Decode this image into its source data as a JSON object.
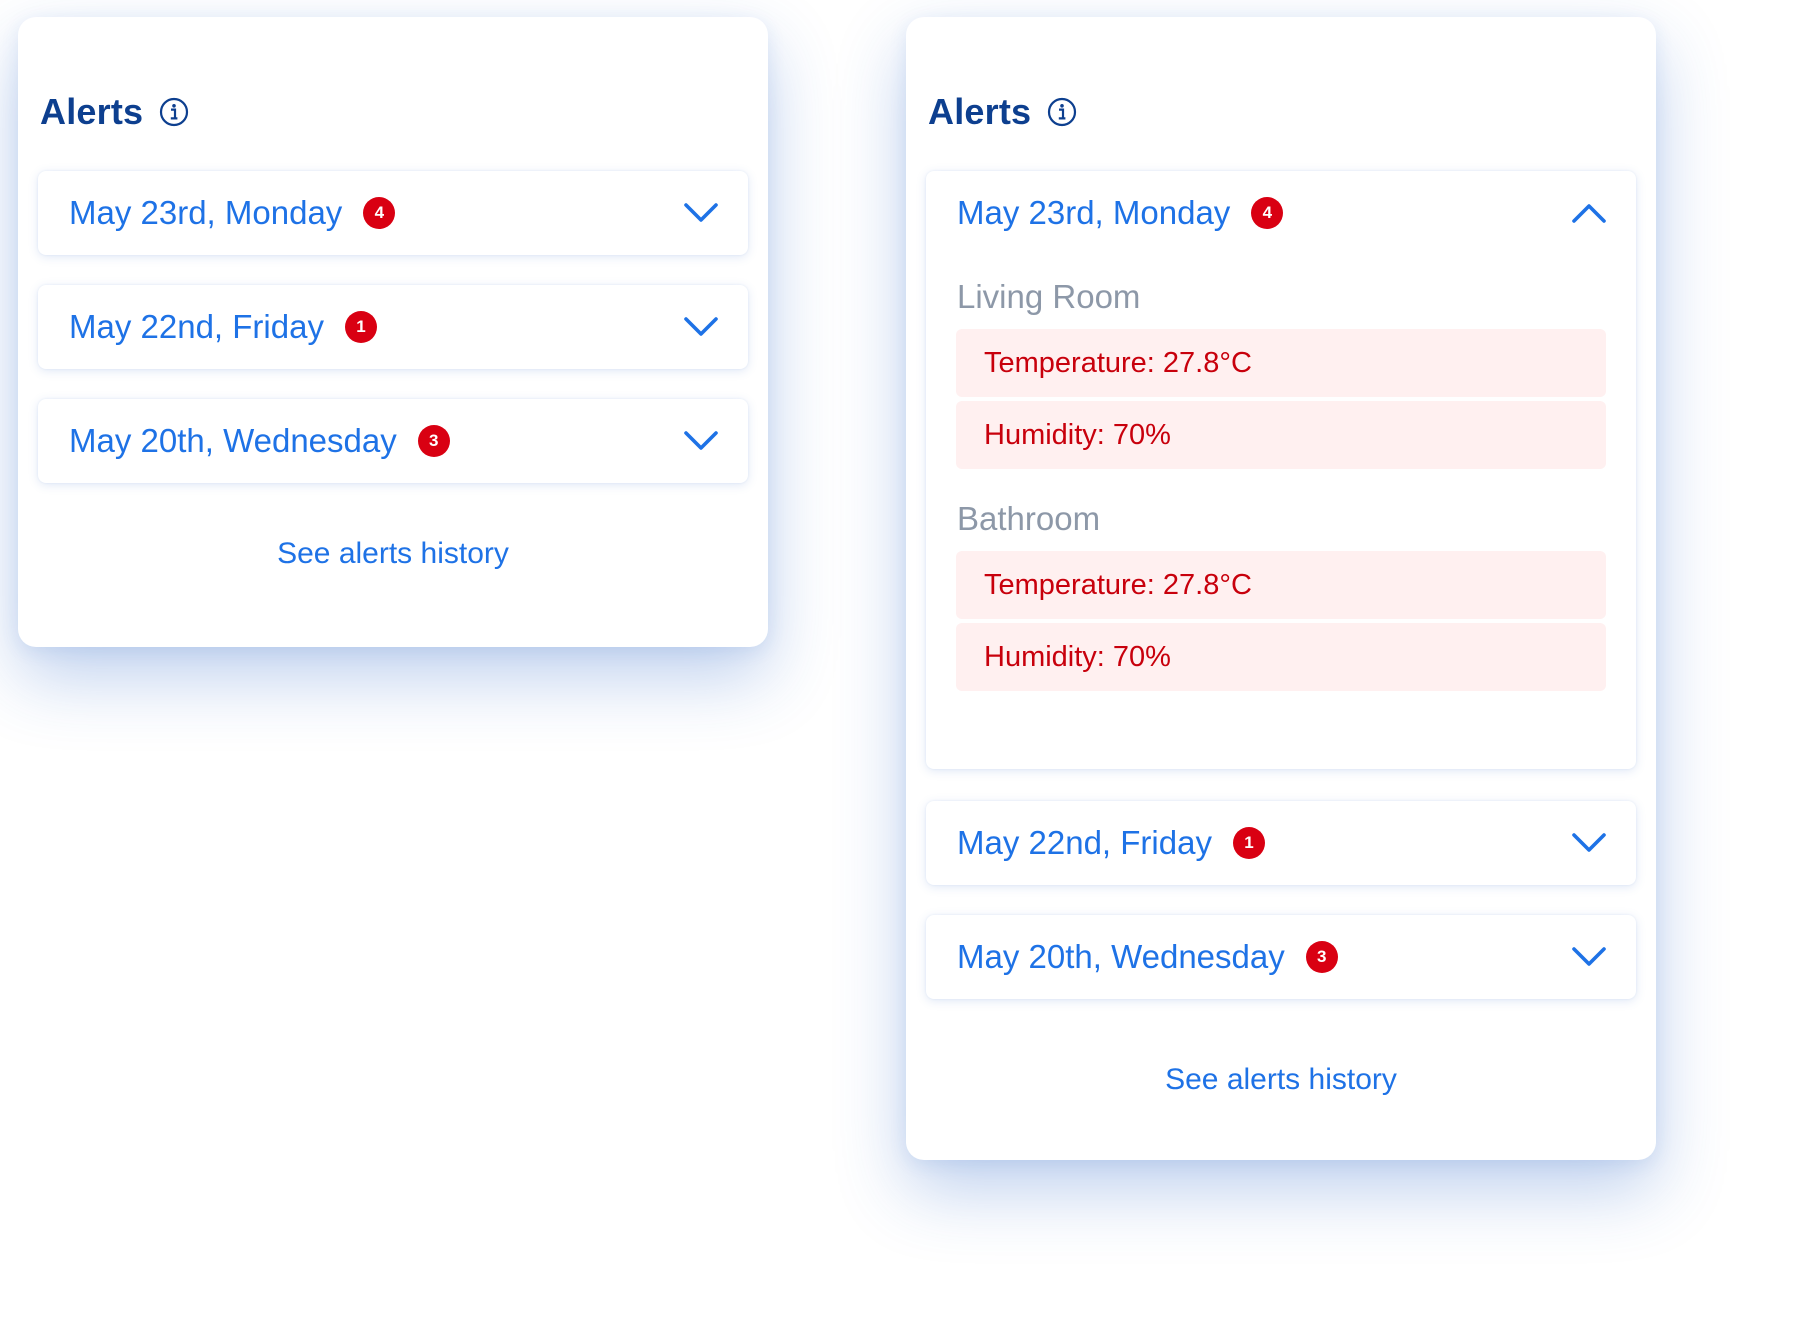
{
  "panels": [
    {
      "title": "Alerts",
      "info_icon": "info-icon",
      "days": [
        {
          "label": "May 23rd, Monday",
          "count": "4",
          "expanded": false,
          "chevron": "chevron-down-icon"
        },
        {
          "label": "May 22nd, Friday",
          "count": "1",
          "expanded": false,
          "chevron": "chevron-down-icon"
        },
        {
          "label": "May 20th, Wednesday",
          "count": "3",
          "expanded": false,
          "chevron": "chevron-down-icon"
        }
      ],
      "history_link": "See alerts history"
    },
    {
      "title": "Alerts",
      "info_icon": "info-icon",
      "days": [
        {
          "label": "May 23rd, Monday",
          "count": "4",
          "expanded": true,
          "chevron": "chevron-up-icon",
          "rooms": [
            {
              "name": "Living Room",
              "alerts": [
                "Temperature: 27.8°C",
                "Humidity: 70%"
              ]
            },
            {
              "name": "Bathroom",
              "alerts": [
                "Temperature: 27.8°C",
                "Humidity: 70%"
              ]
            }
          ]
        },
        {
          "label": "May 22nd, Friday",
          "count": "1",
          "expanded": false,
          "chevron": "chevron-down-icon"
        },
        {
          "label": "May 20th, Wednesday",
          "count": "3",
          "expanded": false,
          "chevron": "chevron-down-icon"
        }
      ],
      "history_link": "See alerts history"
    }
  ],
  "colors": {
    "title": "#0d3f8f",
    "accent": "#1e72e6",
    "badge": "#d90012",
    "alert_text": "#c8000c",
    "alert_bg": "#fff0f0",
    "room_label": "#8d98a8"
  }
}
